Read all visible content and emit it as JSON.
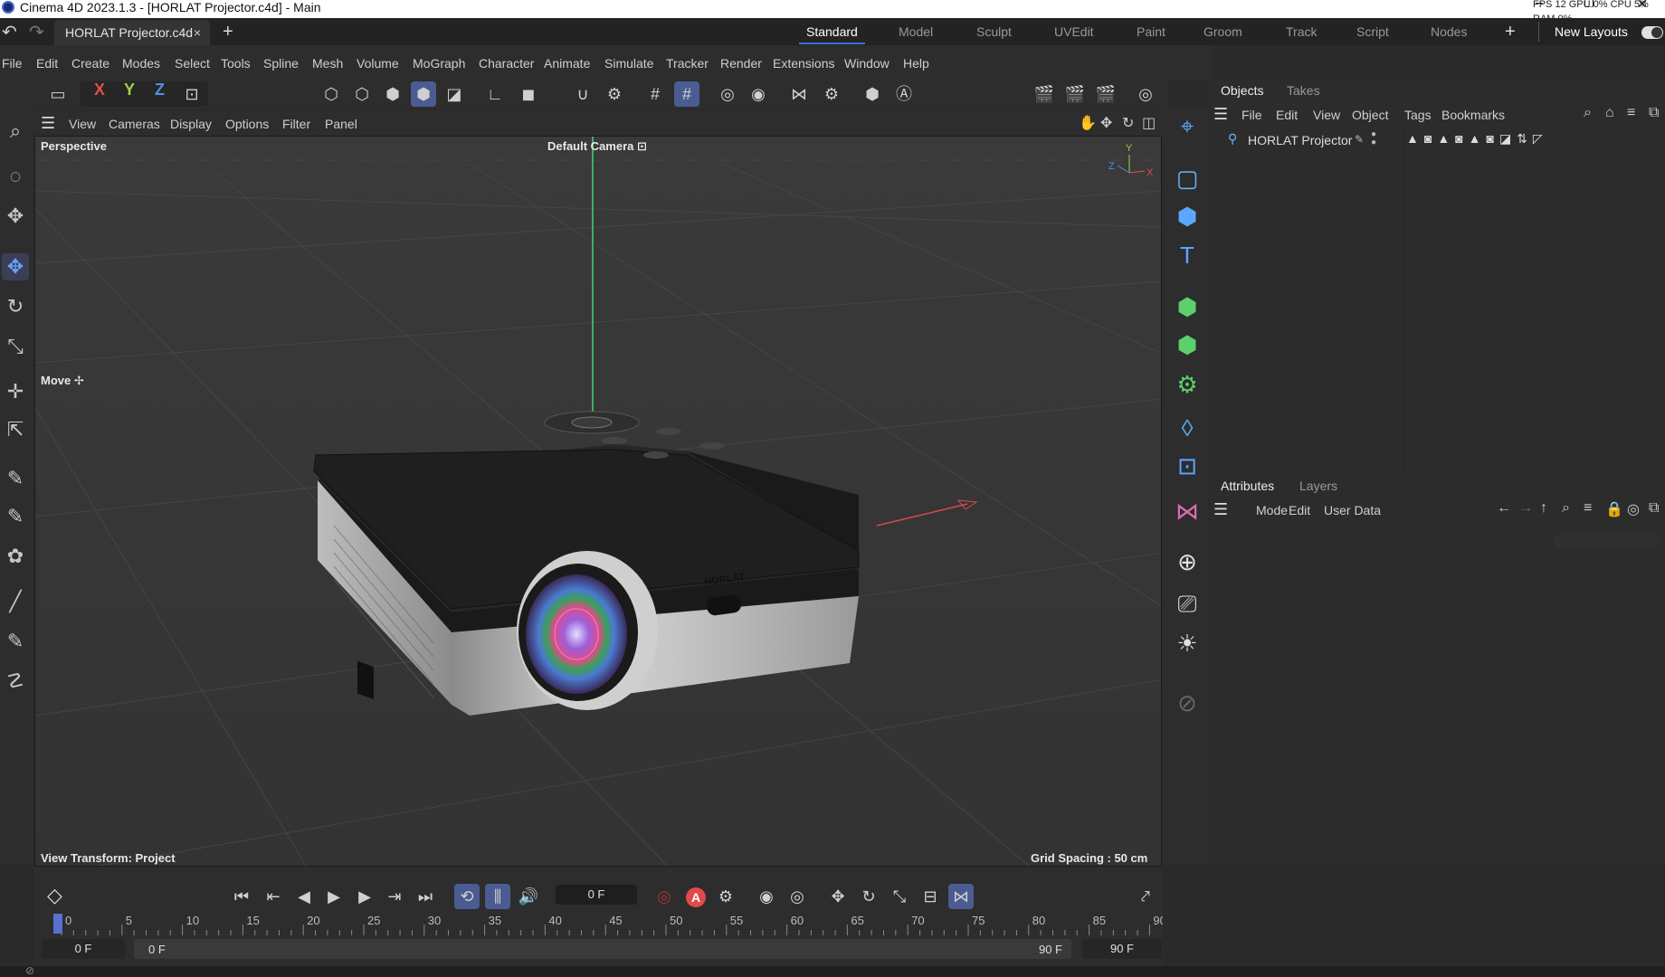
{
  "window": {
    "title": "Cinema 4D 2023.1.3 - [HORLAT Projector.c4d] - Main",
    "controls": [
      "–",
      "❐",
      "✕"
    ],
    "hud": "FPS 12   GPU 0%   CPU 5%   RAM 0%"
  },
  "tabs": {
    "document": "HORLAT Projector.c4d",
    "close": "×",
    "add": "+"
  },
  "layouts": {
    "items": [
      "Standard",
      "Model",
      "Sculpt",
      "UVEdit",
      "Paint",
      "Groom",
      "Track",
      "Script",
      "Nodes"
    ],
    "active": "Standard",
    "add": "+",
    "new_layouts": "New Layouts"
  },
  "menu": [
    "File",
    "Edit",
    "Create",
    "Modes",
    "Select",
    "Tools",
    "Spline",
    "Mesh",
    "Volume",
    "MoGraph",
    "Character",
    "Animate",
    "Simulate",
    "Tracker",
    "Render",
    "Extensions",
    "Window",
    "Help"
  ],
  "toolbar": {
    "axes": [
      "X",
      "Y",
      "Z"
    ],
    "axis_colors": [
      "#e0504a",
      "#9ed04a",
      "#4a90e0"
    ]
  },
  "viewport_menu": [
    "View",
    "Cameras",
    "Display",
    "Options",
    "Filter",
    "Panel"
  ],
  "viewport": {
    "projection": "Perspective",
    "camera": "Default Camera",
    "camera_icon": "⊡",
    "tool": "Move",
    "tool_icon": "✢",
    "view_transform": "View Transform: Project",
    "grid_spacing": "Grid Spacing : 50 cm",
    "model_brand": "HORLAT",
    "axis_labels": {
      "x": "X",
      "y": "Y",
      "z": "Z"
    }
  },
  "objects_panel": {
    "tabs": [
      "Objects",
      "Takes"
    ],
    "menu": [
      "File",
      "Edit",
      "View",
      "Object",
      "Tags",
      "Bookmarks"
    ],
    "items": [
      {
        "name": "HORLAT Projector"
      }
    ]
  },
  "attributes_panel": {
    "tabs": [
      "Attributes",
      "Layers"
    ],
    "menu": [
      "Mode",
      "Edit",
      "User Data"
    ]
  },
  "timeline": {
    "current_frame": "0 F",
    "ticks": [
      "0",
      "5",
      "10",
      "15",
      "20",
      "25",
      "30",
      "35",
      "40",
      "45",
      "50",
      "55",
      "60",
      "65",
      "70",
      "75",
      "80",
      "85",
      "90"
    ],
    "start_field": "0 F",
    "range_start": "0 F",
    "range_end": "90 F",
    "end_field": "90 F",
    "record_label": "A"
  }
}
